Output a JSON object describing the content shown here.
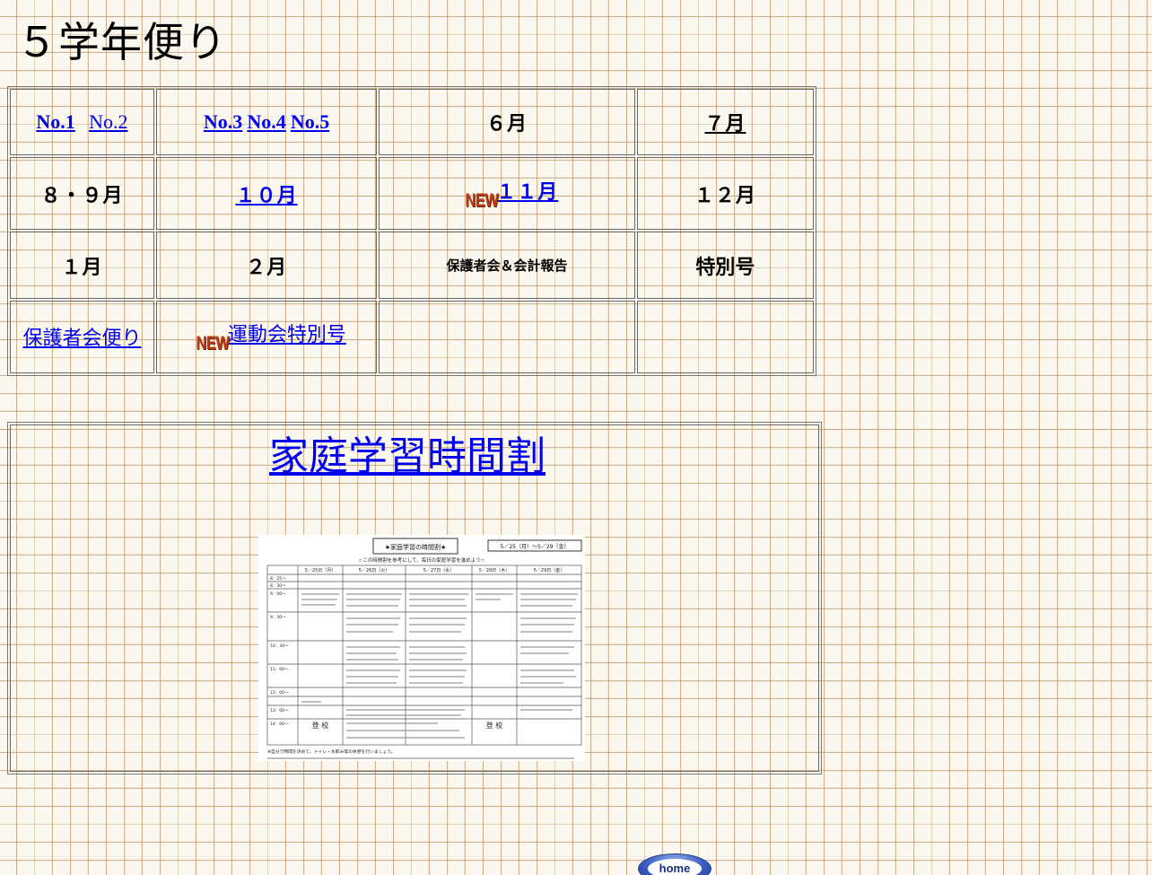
{
  "page_title": "５学年便り",
  "new_badge": "NEW",
  "newsletters": {
    "row1": {
      "no1": "No.1",
      "no2": "No.2",
      "no3": "No.3",
      "no4": "No.4",
      "no5": "No.5",
      "june": "６月",
      "july": "７月"
    },
    "row2": {
      "aug_sep": "８・９月",
      "october": "１０月",
      "november": "１１月",
      "december": "１２月"
    },
    "row3": {
      "january": "１月",
      "february": "２月",
      "parents_report": "保護者会＆会計報告",
      "special": "特別号"
    },
    "row4": {
      "parents_letter": "保護者会便り",
      "sports_day_special": "運動会特別号"
    }
  },
  "timetable": {
    "link_label": "家庭学習時間割",
    "thumbnail": {
      "title": "★家庭学習の時間割★",
      "date_range": "5／25（月）～5／29（金）",
      "subtitle": "☆この時間割を参考にして、毎日の家庭学習を進めよう☆",
      "days": [
        "5／25日（月）",
        "5／26日（火）",
        "5／27日（水）",
        "5／28日（木）",
        "5／29日（金）"
      ],
      "times": [
        "8：25～",
        "8：30～",
        "9：00～",
        "9：30～",
        "10：30～",
        "11：00～",
        "12：00～",
        "13：00～",
        "14：00～"
      ],
      "arrival_label": "登 校",
      "footnote": "※自分で時間を決めて、トイレ・水飲み等の休憩を行いましょう。"
    }
  },
  "home_button": "home",
  "colors": {
    "link": "#0000ee",
    "new_badge": "#b83a12",
    "grid_line": "#be9669"
  }
}
